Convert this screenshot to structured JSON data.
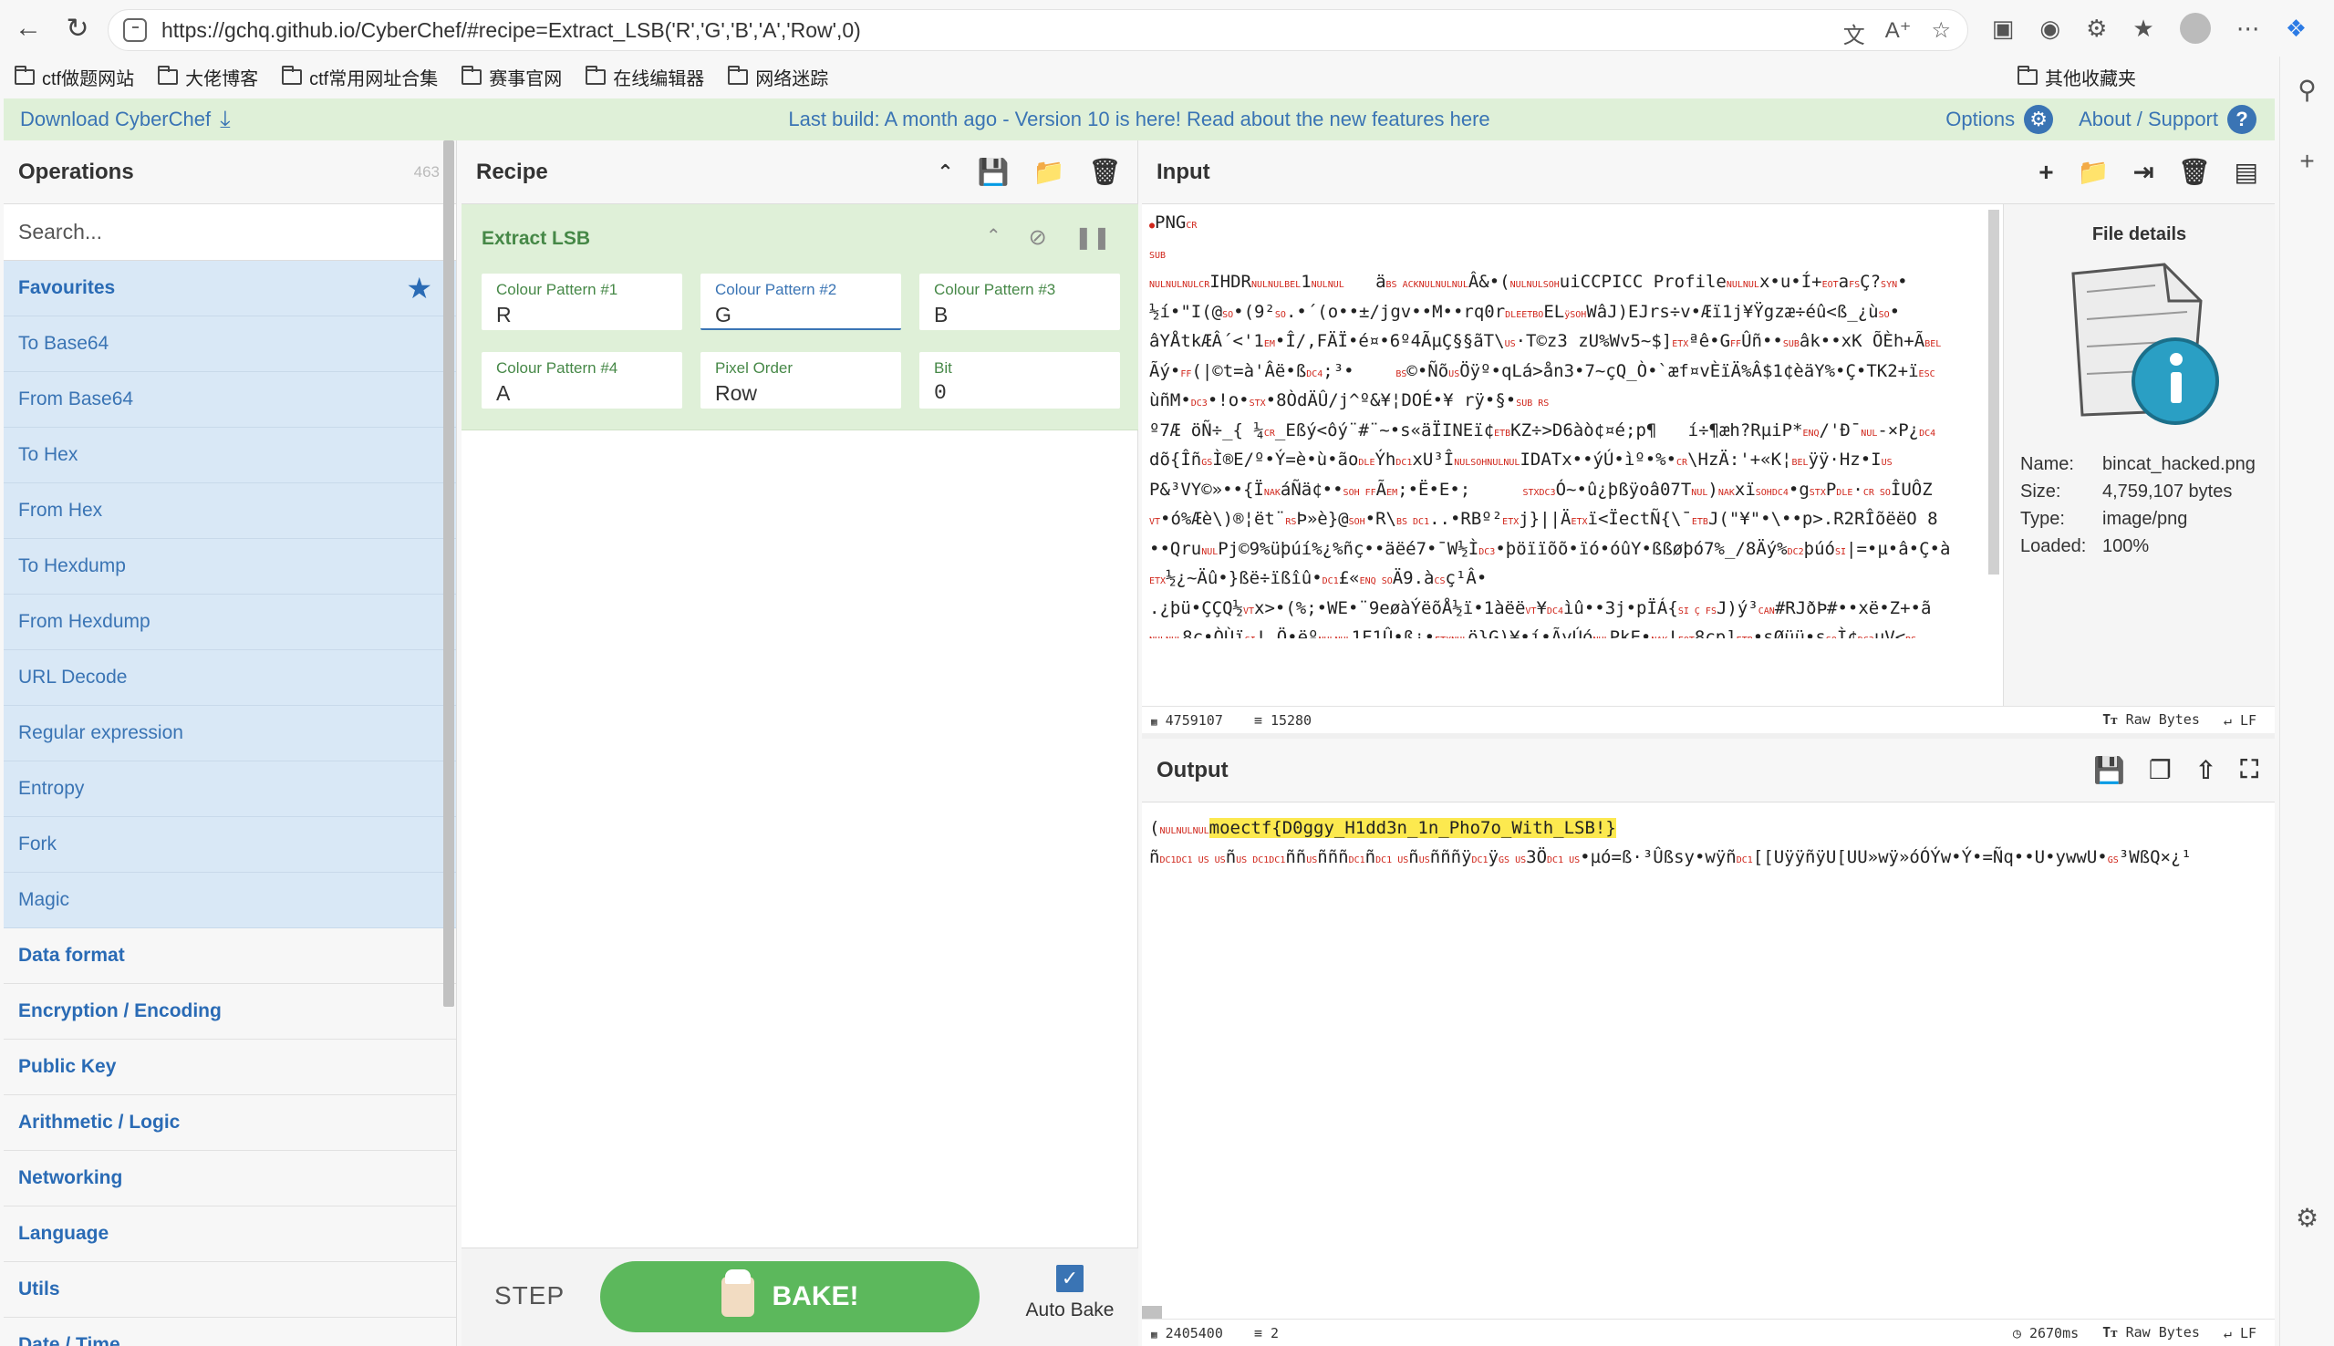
{
  "browser": {
    "url": "https://gchq.github.io/CyberChef/#recipe=Extract_LSB('R','G','B','A','Row',0)",
    "bookmarks": [
      "ctf做题网站",
      "大佬博客",
      "ctf常用网址合集",
      "赛事官网",
      "在线编辑器",
      "网络迷踪"
    ],
    "other_bookmarks": "其他收藏夹"
  },
  "banner": {
    "download": "Download CyberChef",
    "message": "Last build: A month ago - Version 10 is here! Read about the new features here",
    "options": "Options",
    "about": "About / Support"
  },
  "operations": {
    "title": "Operations",
    "count": "463",
    "search_placeholder": "Search...",
    "favourites": "Favourites",
    "items": [
      "To Base64",
      "From Base64",
      "To Hex",
      "From Hex",
      "To Hexdump",
      "From Hexdump",
      "URL Decode",
      "Regular expression",
      "Entropy",
      "Fork",
      "Magic"
    ],
    "categories": [
      "Data format",
      "Encryption / Encoding",
      "Public Key",
      "Arithmetic / Logic",
      "Networking",
      "Language",
      "Utils",
      "Date / Time"
    ]
  },
  "recipe": {
    "title": "Recipe",
    "operation": "Extract LSB",
    "args": [
      {
        "label": "Colour Pattern #1",
        "value": "R"
      },
      {
        "label": "Colour Pattern #2",
        "value": "G"
      },
      {
        "label": "Colour Pattern #3",
        "value": "B"
      },
      {
        "label": "Colour Pattern #4",
        "value": "A"
      },
      {
        "label": "Pixel Order",
        "value": "Row"
      },
      {
        "label": "Bit",
        "value": "0"
      }
    ],
    "step": "STEP",
    "bake": "BAKE!",
    "auto_bake": "Auto Bake"
  },
  "input": {
    "title": "Input",
    "length": "4759107",
    "lines": "15280",
    "encoding": "Raw Bytes",
    "eol": "LF",
    "file": {
      "title": "File details",
      "name_key": "Name:",
      "name": "bincat_hacked.png",
      "size_key": "Size:",
      "size": "4,759,107 bytes",
      "type_key": "Type:",
      "type": "image/png",
      "loaded_key": "Loaded:",
      "loaded": "100%"
    }
  },
  "output": {
    "title": "Output",
    "flag": "moectf{D0ggy_H1dd3n_1n_Pho7o_With_LSB!}",
    "length": "2405400",
    "lines": "2",
    "time": "2670ms",
    "encoding": "Raw Bytes",
    "eol": "LF"
  }
}
